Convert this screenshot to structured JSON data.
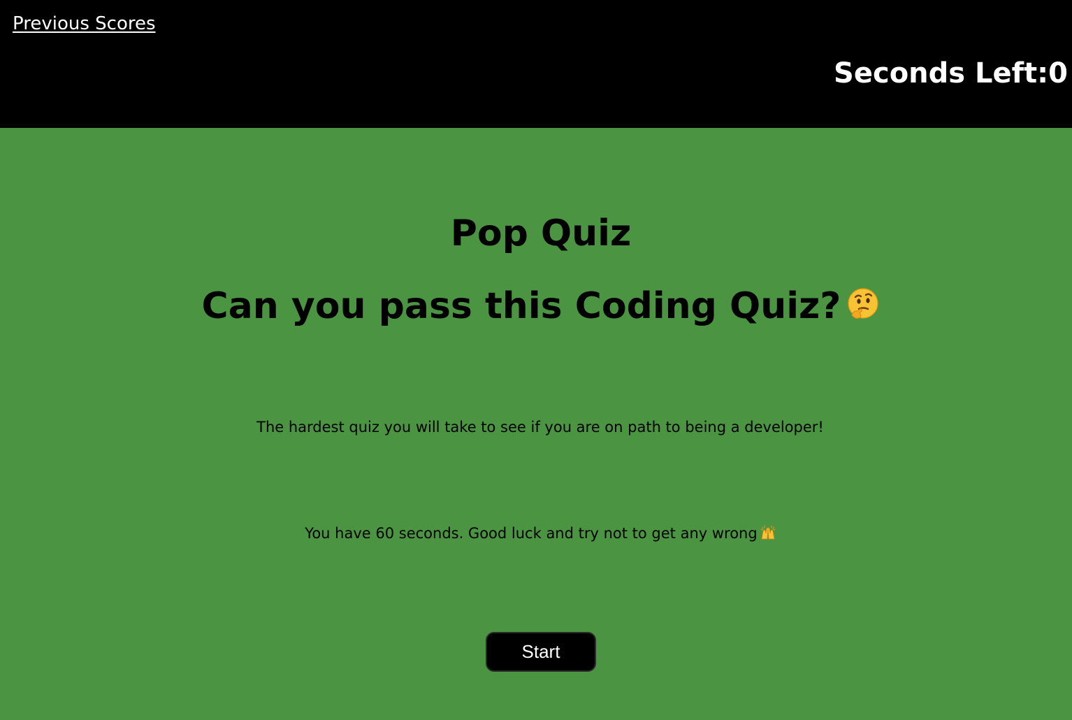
{
  "header": {
    "previous_scores_label": "Previous Scores",
    "timer_label": "Seconds Left:",
    "timer_value": "0"
  },
  "main": {
    "title": "Pop Quiz",
    "subtitle": "Can you pass this Coding Quiz?",
    "subtitle_emoji": "thinking-face-icon",
    "description": "The hardest quiz you will take to see if you are on path to being a developer!",
    "instructions": "You have 60 seconds. Good luck and try not to get any wrong",
    "instructions_emoji": "raising-hands-icon",
    "start_label": "Start"
  },
  "colors": {
    "header_bg": "#000000",
    "main_bg": "#4b9442",
    "button_bg": "#000000",
    "text_light": "#ffffff",
    "text_dark": "#000000"
  }
}
